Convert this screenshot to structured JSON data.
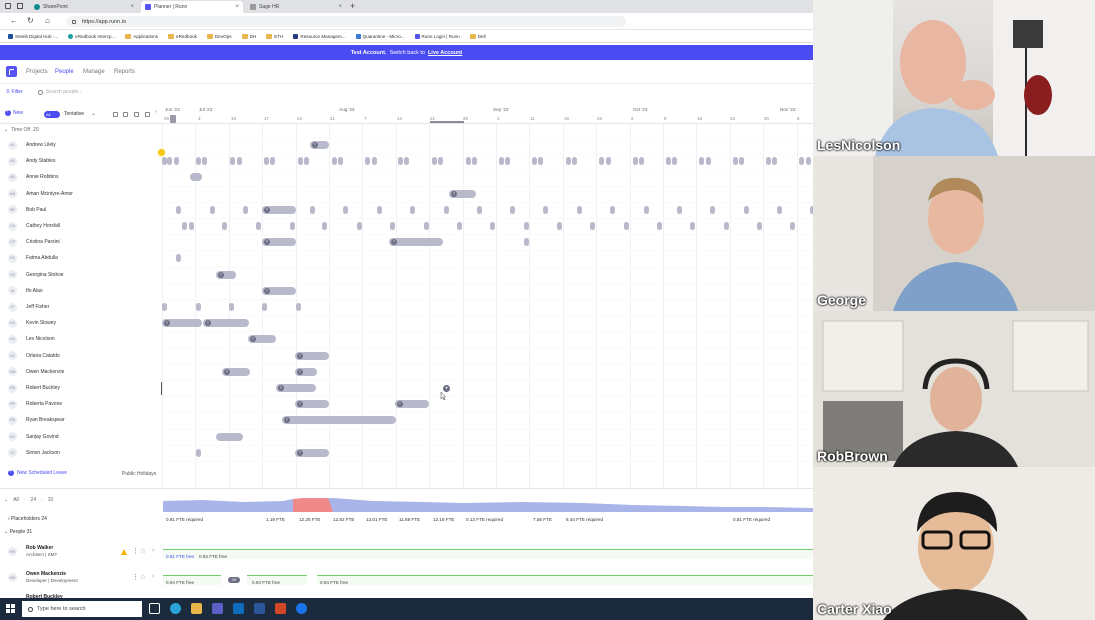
{
  "browser": {
    "tabs": [
      {
        "label": "SharePoint",
        "active": false
      },
      {
        "label": "Planner | Runn",
        "active": true
      },
      {
        "label": "Sage HR",
        "active": false
      }
    ],
    "url": "https://app.runn.io",
    "bookmarks": [
      "Steelit Digital Hub -...",
      "eRedbook Intercp...",
      "Applications",
      "eRedbook",
      "DevOps",
      "DH",
      "ETH",
      "Resource Managem...",
      "Quarantine - Micro...",
      "Runn Login | Runn",
      "Dell"
    ]
  },
  "banner": {
    "prefix": "Test Account.",
    "middle": "Switch back to",
    "link": "Live Account"
  },
  "nav": {
    "items": [
      "Projects",
      "People",
      "Manage",
      "Reports"
    ],
    "active": "People"
  },
  "toolbar": {
    "filter": "Filter",
    "search_placeholder": "Search people..."
  },
  "timeline": {
    "new_label": "New",
    "toggle_label": "All",
    "tentative_label": "Tentative",
    "months": [
      "Jun '23",
      "Jul '23",
      "Aug '23",
      "Sep '23",
      "Oct '23",
      "Nov '23"
    ],
    "days": [
      "26",
      "3",
      "10",
      "17",
      "24",
      "31",
      "7",
      "14",
      "21",
      "28",
      "4",
      "11",
      "18",
      "25",
      "2",
      "9",
      "16",
      "23",
      "30",
      "6"
    ],
    "section_label": "Time Off",
    "section_count": "20"
  },
  "people": [
    {
      "initials": "AL",
      "name": "Andrew Lilely"
    },
    {
      "initials": "AS",
      "name": "Andy Stables"
    },
    {
      "initials": "AR",
      "name": "Annie Robbins"
    },
    {
      "initials": "AM",
      "name": "Aman Mcintyre-Amor"
    },
    {
      "initials": "BP",
      "name": "Bob Paul"
    },
    {
      "initials": "CH",
      "name": "Cathey Horsfall"
    },
    {
      "initials": "CP",
      "name": "Cristina Parsini"
    },
    {
      "initials": "FA",
      "name": "Fatma Abdulla"
    },
    {
      "initials": "GS",
      "name": "Georgina Stokoe"
    },
    {
      "initials": "IA",
      "name": "Ifo Alao"
    },
    {
      "initials": "JF",
      "name": "Jeff Fisher"
    },
    {
      "initials": "KS",
      "name": "Kevin Slowey"
    },
    {
      "initials": "LN",
      "name": "Les Nicolson"
    },
    {
      "initials": "OC",
      "name": "Orlaria Cataldo"
    },
    {
      "initials": "OM",
      "name": "Owen Mackenzie"
    },
    {
      "initials": "RB",
      "name": "Robert Buckley"
    },
    {
      "initials": "RP",
      "name": "Roberta Pavone"
    },
    {
      "initials": "RB",
      "name": "Ryan Breakspear"
    },
    {
      "initials": "SG",
      "name": "Sanjay Govind"
    },
    {
      "initials": "SJ",
      "name": "Simon Jackson"
    }
  ],
  "schedule_footer": {
    "new_leave": "New Scheduled Leave",
    "public_holidays": "Public Holidays"
  },
  "lower": {
    "all_label": "All",
    "all_count_a": "24",
    "all_count_b": "31",
    "fte_values": [
      "0.81 FTE required",
      "1.19 FTE",
      "12.25 FTE",
      "12.82 FTE",
      "13.01 FTE",
      "11.88 FTE",
      "12.16 FTE",
      "0.13 FTE required",
      "7.56 FTE",
      "6.44 FTE required",
      "0.81 FTE required"
    ],
    "placeholders_label": "Placeholders",
    "placeholders_count": "24",
    "people_label": "People",
    "people_count": "31",
    "rows": [
      {
        "initials": "RW",
        "name": "Rob Walker",
        "role": "Architect | SMT",
        "avail": [
          "0.81 FTE free",
          "0.94 FTE free"
        ]
      },
      {
        "initials": "OM",
        "name": "Owen Mackenzie",
        "role": "Developer | Development",
        "avail": [
          "0.94 FTE free",
          "0.94 FTE free",
          "0.94 FTE free"
        ],
        "badge": "Off"
      },
      {
        "initials": "RB",
        "name": "Robert Buckley",
        "role": ""
      }
    ]
  },
  "taskbar": {
    "search_placeholder": "Type here to search"
  },
  "participants": [
    "LesNicolson",
    "George",
    "RobBrown",
    "Carter Xiao"
  ]
}
